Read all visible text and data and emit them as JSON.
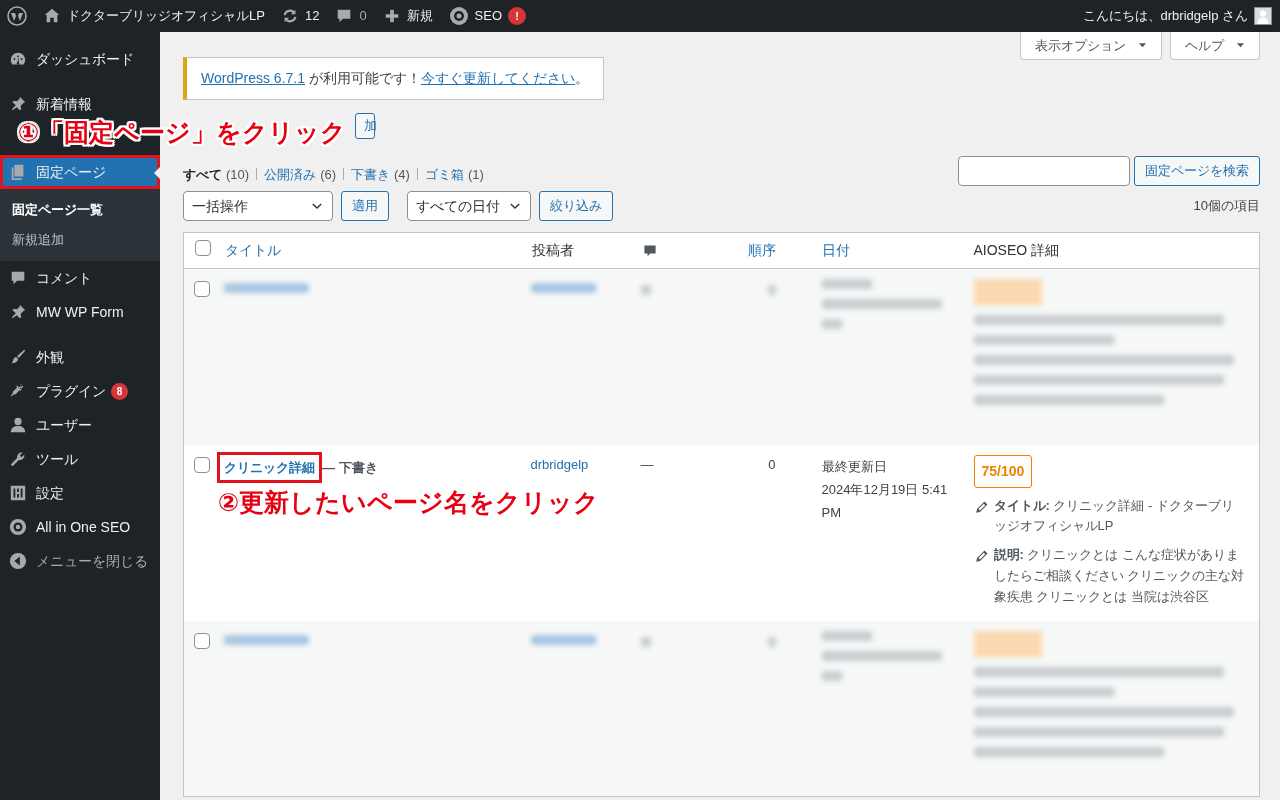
{
  "admin_bar": {
    "site_name": "ドクターブリッジオフィシャルLP",
    "updates": "12",
    "comments": "0",
    "new_label": "新規",
    "seo_label": "SEO",
    "seo_alert": "!",
    "greeting": "こんにちは、drbridgelp さん"
  },
  "sidebar": {
    "items": [
      {
        "kind": "item",
        "label": "ダッシュボード",
        "current": false
      },
      {
        "kind": "separator"
      },
      {
        "kind": "item",
        "label": "新着情報",
        "current": false
      },
      {
        "kind": "covered"
      },
      {
        "kind": "item",
        "label": "固定ページ",
        "current": true,
        "highlighted": true,
        "submenu": [
          {
            "label": "固定ページ一覧",
            "selected": true
          },
          {
            "label": "新規追加",
            "selected": false
          }
        ]
      },
      {
        "kind": "item",
        "label": "コメント",
        "current": false
      },
      {
        "kind": "item",
        "label": "MW WP Form",
        "current": false
      },
      {
        "kind": "separator"
      },
      {
        "kind": "item",
        "label": "外観",
        "current": false
      },
      {
        "kind": "item",
        "label": "プラグイン",
        "current": false,
        "badge": "8"
      },
      {
        "kind": "item",
        "label": "ユーザー",
        "current": false
      },
      {
        "kind": "item",
        "label": "ツール",
        "current": false
      },
      {
        "kind": "item",
        "label": "設定",
        "current": false
      },
      {
        "kind": "item",
        "label": "All in One SEO",
        "current": false
      },
      {
        "kind": "collapse",
        "label": "メニューを閉じる",
        "current": false
      }
    ]
  },
  "screen_buttons": [
    "表示オプション",
    "ヘルプ"
  ],
  "notice": [
    {
      "kind": "link",
      "text": "WordPress 6.7.1"
    },
    {
      "kind": "text",
      "text": " が利用可能です！"
    },
    {
      "kind": "link",
      "text": "今すぐ更新してください"
    },
    {
      "kind": "text",
      "text": "。"
    }
  ],
  "add_button": "加",
  "views": [
    {
      "label": "すべて",
      "count": "(10)",
      "selected": true
    },
    {
      "label": "公開済み",
      "count": "(6)",
      "selected": false
    },
    {
      "label": "下書き",
      "count": "(4)",
      "selected": false
    },
    {
      "label": "ゴミ箱",
      "count": "(1)",
      "selected": false
    }
  ],
  "search_button": "固定ページを検索",
  "bulk_select": "一括操作",
  "apply_button": "適用",
  "date_select": "すべての日付",
  "filter_button": "絞り込み",
  "item_count": "10個の項目",
  "table": {
    "columns": [
      {
        "kind": "check",
        "checked": false
      },
      {
        "kind": "sortable",
        "label": "タイトル"
      },
      {
        "kind": "plain",
        "label": "投稿者"
      },
      {
        "kind": "comments"
      },
      {
        "kind": "sortable",
        "label": "順序"
      },
      {
        "kind": "sortable",
        "label": "日付"
      },
      {
        "kind": "plain",
        "label": "AIOSEO 詳細"
      }
    ],
    "rows": [
      {
        "kind": "blurred",
        "checked": false
      },
      {
        "kind": "page",
        "checked": false,
        "title": "クリニック詳細",
        "highlighted": true,
        "state": "— 下書き",
        "author": "drbridgelp",
        "comments": "—",
        "order": "0",
        "date_label": "最終更新日",
        "date": "2024年12月19日 5:41 PM",
        "score": "75/100",
        "seo_title": "**タイトル:** クリニック詳細 - ドクターブリッジオフィシャルLP",
        "seo_description": "**説明:** クリニックとは こんな症状がありましたらご相談ください クリニックの主な対象疾患 クリニックとは 当院は渋谷区"
      },
      {
        "kind": "blurred",
        "checked": false
      }
    ]
  },
  "annotations": [
    {
      "text": "①「固定ページ」をクリック"
    },
    {
      "text": "②更新したいページ名をクリック"
    }
  ]
}
